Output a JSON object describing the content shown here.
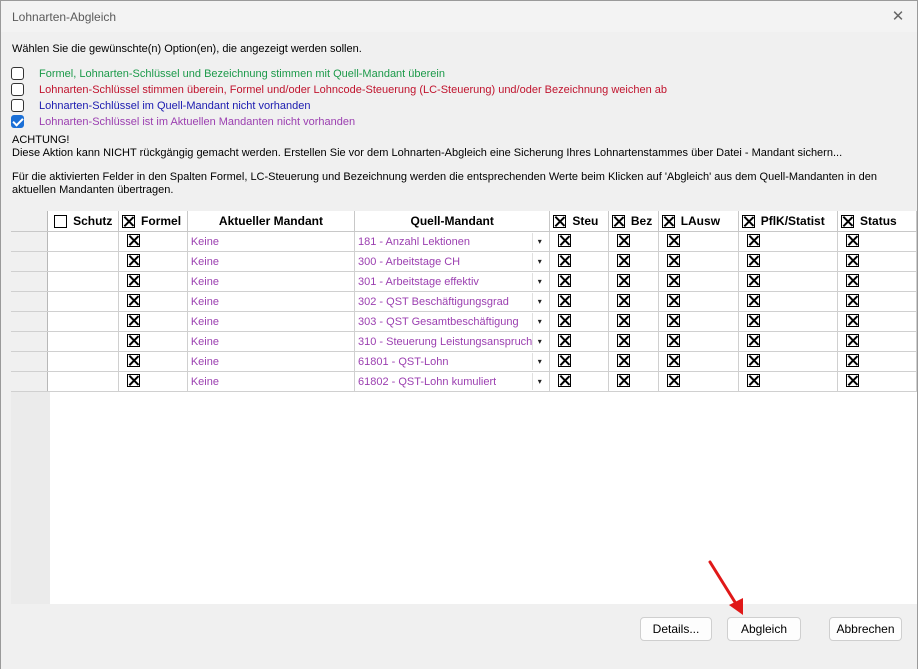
{
  "window": {
    "title": "Lohnarten-Abgleich",
    "close_glyph": "✕"
  },
  "instruction": "Wählen Sie die gewünschte(n) Option(en), die angezeigt werden sollen.",
  "options": [
    {
      "label": "Formel, Lohnarten-Schlüssel und Bezeichnung stimmen mit Quell-Mandant überein",
      "checked": false,
      "color": "#1c9a4a"
    },
    {
      "label": "Lohnarten-Schlüssel stimmen überein, Formel und/oder Lohncode-Steuerung (LC-Steuerung) und/oder Bezeichnung weichen ab",
      "checked": false,
      "color": "#c0142e"
    },
    {
      "label": "Lohnarten-Schlüssel im Quell-Mandant nicht vorhanden",
      "checked": false,
      "color": "#1a1ab0"
    },
    {
      "label": "Lohnarten-Schlüssel ist im Aktuellen Mandanten nicht vorhanden",
      "checked": true,
      "color": "#9b3fb0"
    }
  ],
  "warning": {
    "title": "ACHTUNG!",
    "text": "Diese Aktion kann NICHT rückgängig gemacht werden. Erstellen Sie vor dem Lohnarten-Abgleich eine Sicherung Ihres Lohnartenstammes über Datei - Mandant sichern..."
  },
  "info": "Für die aktivierten Felder in den Spalten Formel, LC-Steuerung und Bezeichnung werden die entsprechenden Werte beim Klicken auf 'Abgleich' aus dem Quell-Mandanten in den aktuellen Mandanten übertragen.",
  "table": {
    "headers": {
      "schutz": "Schutz",
      "formel": "Formel",
      "aktueller": "Aktueller Mandant",
      "quell": "Quell-Mandant",
      "steu": "Steu",
      "bez": "Bez",
      "lausw": "LAusw",
      "pflk": "PflK/Statist",
      "status": "Status"
    },
    "rows": [
      {
        "aktueller": "Keine",
        "quell": "181 - Anzahl Lektionen"
      },
      {
        "aktueller": "Keine",
        "quell": "300 - Arbeitstage CH"
      },
      {
        "aktueller": "Keine",
        "quell": "301 - Arbeitstage effektiv"
      },
      {
        "aktueller": "Keine",
        "quell": "302 - QST Beschäftigungsgrad"
      },
      {
        "aktueller": "Keine",
        "quell": "303 - QST Gesamtbeschäftigung"
      },
      {
        "aktueller": "Keine",
        "quell": "310 - Steuerung Leistungsanspruch"
      },
      {
        "aktueller": "Keine",
        "quell": "61801 - QST-Lohn"
      },
      {
        "aktueller": "Keine",
        "quell": "61802 - QST-Lohn kumuliert"
      }
    ]
  },
  "buttons": {
    "details": "Details...",
    "abgleich": "Abgleich",
    "abbrechen": "Abbrechen"
  },
  "dropdown_glyph": "▾"
}
